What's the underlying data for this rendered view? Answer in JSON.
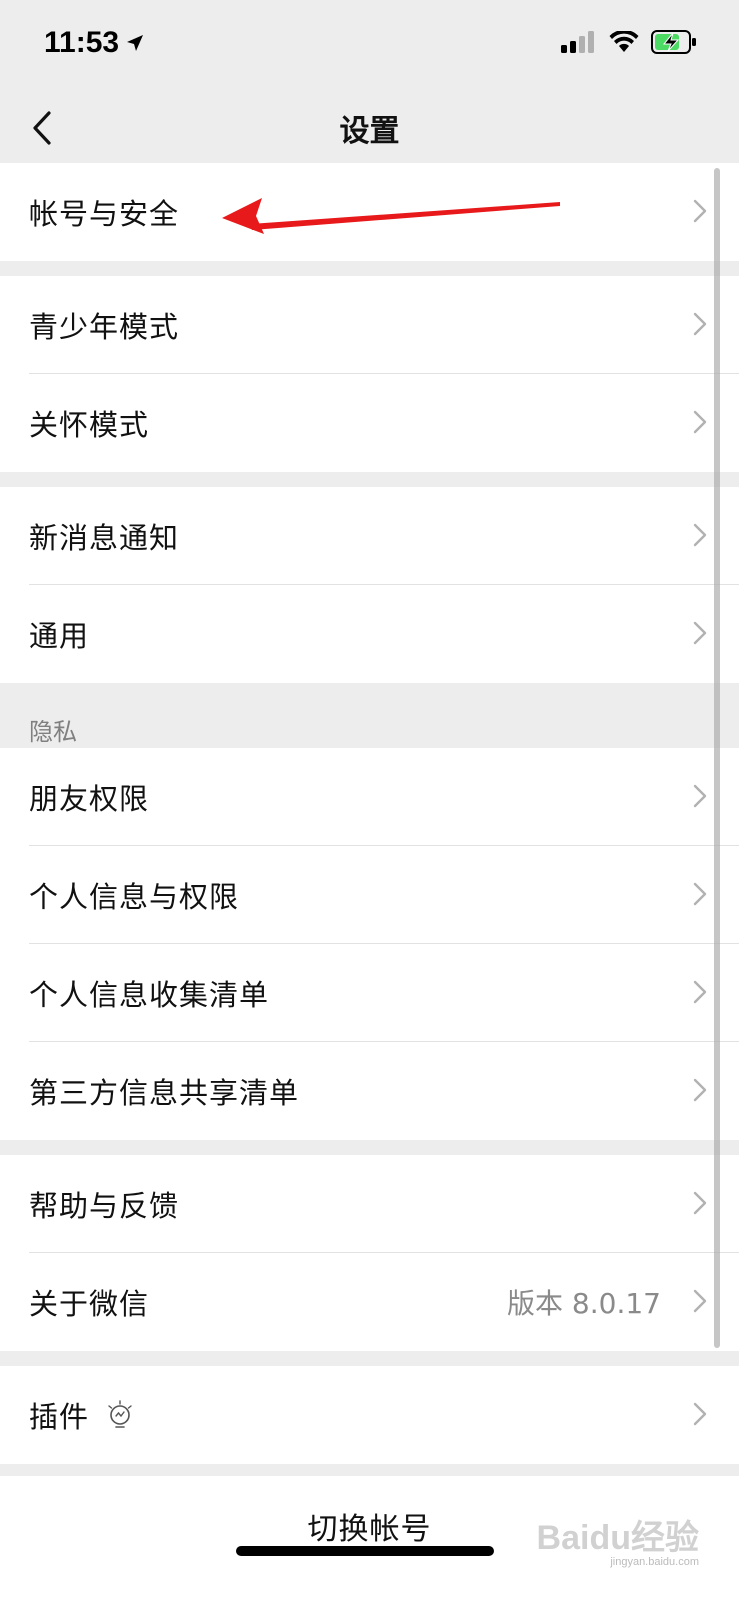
{
  "status_bar": {
    "time": "11:53"
  },
  "nav": {
    "title": "设置"
  },
  "groups": {
    "g1": [
      {
        "label": "帐号与安全"
      }
    ],
    "g2": [
      {
        "label": "青少年模式"
      },
      {
        "label": "关怀模式"
      }
    ],
    "g3": [
      {
        "label": "新消息通知"
      },
      {
        "label": "通用"
      }
    ],
    "privacy_header": "隐私",
    "g4": [
      {
        "label": "朋友权限"
      },
      {
        "label": "个人信息与权限"
      },
      {
        "label": "个人信息收集清单"
      },
      {
        "label": "第三方信息共享清单"
      }
    ],
    "g5": [
      {
        "label": "帮助与反馈"
      },
      {
        "label": "关于微信",
        "value": "版本 8.0.17"
      }
    ],
    "g6": [
      {
        "label": "插件",
        "icon": "lightbulb-icon"
      }
    ]
  },
  "switch_account": {
    "label": "切换帐号"
  },
  "watermark": {
    "text": "Baidu经验",
    "sub": "jingyan.baidu.com"
  },
  "colors": {
    "background": "#ededed",
    "cell": "#ffffff",
    "annotation_arrow": "#e8191a"
  }
}
